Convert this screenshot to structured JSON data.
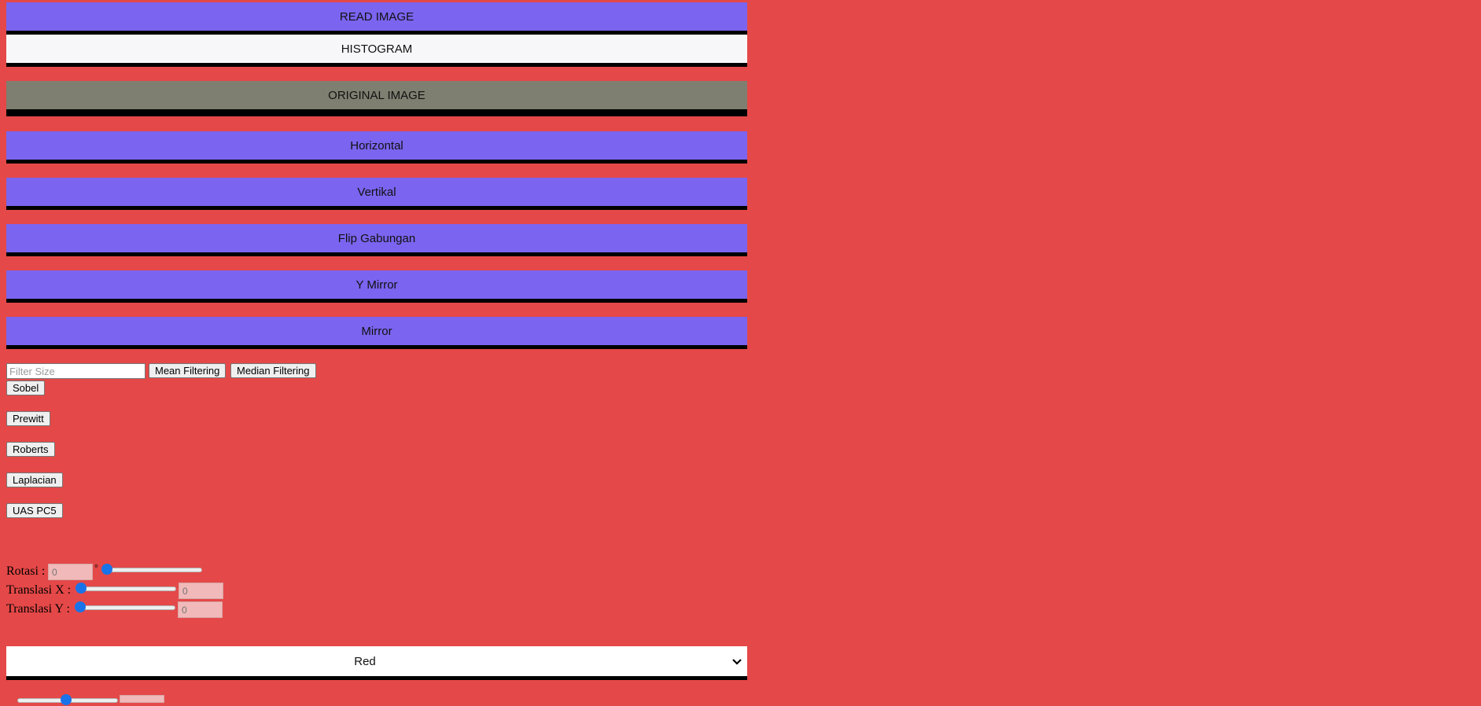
{
  "buttons": {
    "read_image": "READ IMAGE",
    "histogram": "HISTOGRAM",
    "original_image": "ORIGINAL IMAGE",
    "horizontal": "Horizontal",
    "vertikal": "Vertikal",
    "flip_gabungan": "Flip Gabungan",
    "y_mirror": "Y Mirror",
    "mirror": "Mirror"
  },
  "filter": {
    "size_placeholder": "Filter Size",
    "mean_label": "Mean Filtering",
    "median_label": "Median Filtering"
  },
  "edge": {
    "sobel": "Sobel",
    "prewitt": "Prewitt",
    "roberts": "Roberts",
    "laplacian": "Laplacian",
    "uas": "UAS PC5"
  },
  "transform": {
    "rotasi_label": "Rotasi :",
    "rotasi_value": "0",
    "degree_symbol": "°",
    "rotasi_slider": 0,
    "translasi_x_label": "Translasi X :",
    "translasi_x_value": "0",
    "translasi_x_slider": 0,
    "translasi_y_label": "Translasi Y :",
    "translasi_y_value": "0",
    "translasi_y_slider": 0
  },
  "channel_select": {
    "selected": "Red"
  },
  "colors": {
    "background": "#e54848",
    "button_purple": "#7b64ef",
    "button_gray": "#7e7f70",
    "slider_thumb": "#1a73e8"
  }
}
